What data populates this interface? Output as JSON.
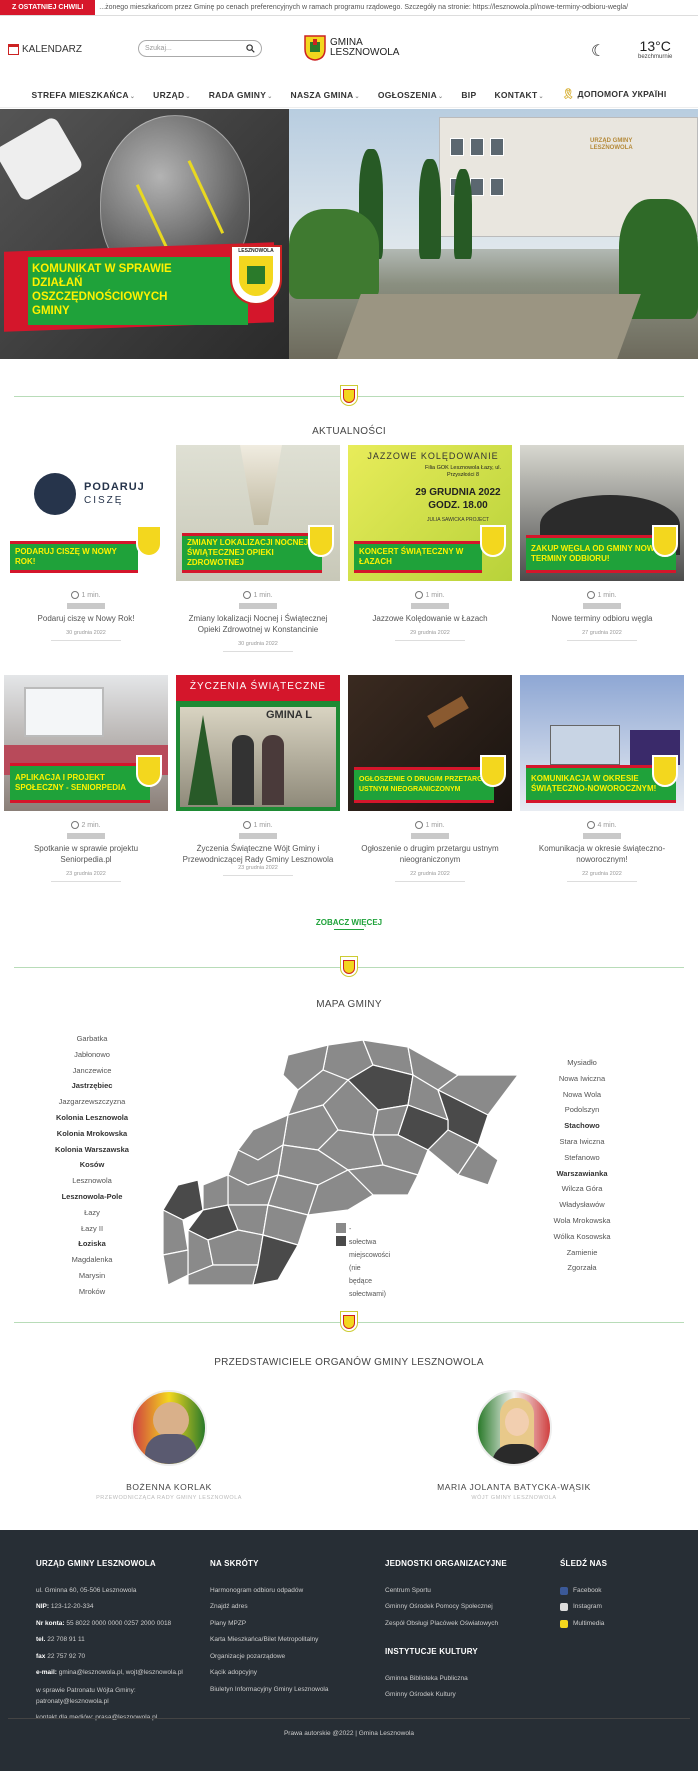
{
  "ticker": {
    "label": "Z OSTATNIEJ CHWILI",
    "text": "...żonego mieszkańcom przez Gminę po cenach preferencyjnych w ramach programu rządowego. Szczegóły na stronie: https://lesznowola.pl/nowe-terminy-odbioru-wegla/"
  },
  "header": {
    "calendar_label": "KALENDARZ",
    "search_placeholder": "Szukaj...",
    "logo_line1": "GMINA",
    "logo_line2": "LESZNOWOLA",
    "temp": "13°C",
    "weather_desc": "bezchmurnie"
  },
  "nav": [
    {
      "label": "STREFA MIESZKAŃCA",
      "caret": "⌄"
    },
    {
      "label": "URZĄD",
      "caret": "⌄"
    },
    {
      "label": "RADA GMINY",
      "caret": "⌄"
    },
    {
      "label": "NASZA GMINA",
      "caret": "⌄"
    },
    {
      "label": "OGŁOSZENIA",
      "caret": "⌄"
    },
    {
      "label": "BIP",
      "caret": ""
    },
    {
      "label": "KONTAKT",
      "caret": "⌄"
    },
    {
      "label": "ДОПОМОГА УКРАЇНІ",
      "caret": ""
    }
  ],
  "hero": {
    "left_banner": "KOMUNIKAT W SPRAWIE DZIAŁAŃ OSZCZĘDNOŚCIOWYCH GMINY",
    "left_crest_label": "LESZNOWOLA",
    "building_sign": "URZĄD GMINY LESZNOWOLA",
    "colors": {
      "red": "#d4162b",
      "green": "#1fa23a",
      "yellow": "#fff200"
    }
  },
  "news": {
    "section_title": "AKTUALNOŚCI",
    "see_more": "ZOBACZ WIĘCEJ",
    "items": [
      {
        "banner": "PODARUJ CISZĘ W NOWY ROK!",
        "time": "1 min.",
        "title": "Podaruj ciszę w Nowy Rok!",
        "date": "30 grudnia 2022",
        "logo_a": "PODARUJ",
        "logo_b": "CISZĘ"
      },
      {
        "banner": "ZMIANY LOKALIZACJI NOCNEJ I ŚWIĄTECZNEJ OPIEKI ZDROWOTNEJ",
        "time": "1 min.",
        "title": "Zmiany lokalizacji Nocnej i Świątecznej Opieki Zdrowotnej w Konstancinie",
        "date": "30 grudnia 2022"
      },
      {
        "banner": "KONCERT ŚWIĄTECZNY W ŁAZACH",
        "time": "1 min.",
        "title": "Jazzowe Kolędowanie w Łazach",
        "date": "29 grudnia 2022",
        "poster_title": "JAZZOWE KOLĘDOWANIE",
        "poster_place": "Filia GOK Lesznowola Łazy, ul. Przyszłości 8",
        "poster_date": "29 GRUDNIA 2022",
        "poster_time": "GODZ. 18.00",
        "poster_artist": "JULIA SAWICKA PROJECT"
      },
      {
        "banner": "ZAKUP WĘGLA OD GMINY NOWE TERMINY ODBIORU!",
        "time": "1 min.",
        "title": "Nowe terminy odbioru węgla",
        "date": "27 grudnia 2022"
      },
      {
        "banner": "APLIKACJA I PROJEKT SPOŁECZNY - SENIORPEDIA",
        "time": "2 min.",
        "title": "Spotkanie w sprawie projektu Seniorpedia.pl",
        "date": "23 grudnia 2022"
      },
      {
        "banner": "",
        "time": "1 min.",
        "title": "Życzenia Świąteczne Wójt Gminy i Przewodniczącej Rady Gminy Lesznowola",
        "date": "23 grudnia 2022",
        "poster_title": "ŻYCZENIA ŚWIĄTECZNE",
        "poster_sign": "GMINA L"
      },
      {
        "banner": "OGŁOSZENIE O DRUGIM PRZETARGU USTNYM NIEOGRANICZONYM",
        "time": "1 min.",
        "title": "Ogłoszenie o drugim przetargu ustnym nieograniczonym",
        "date": "22 grudnia 2022"
      },
      {
        "banner": "KOMUNIKACJA W OKRESIE ŚWIĄTECZNO-NOWOROCZNYM!",
        "time": "4 min.",
        "title": "Komunikacja w okresie świąteczno-noworocznym!",
        "date": "22 grudnia 2022"
      }
    ]
  },
  "map": {
    "section_title": "MAPA GMINY",
    "left_villages": [
      {
        "name": "Garbatka",
        "bold": false
      },
      {
        "name": "Jabłonowo",
        "bold": false
      },
      {
        "name": "Janczewice",
        "bold": false
      },
      {
        "name": "Jastrzębiec",
        "bold": true
      },
      {
        "name": "Jazgarzewszczyzna",
        "bold": false
      },
      {
        "name": "Kolonia Lesznowola",
        "bold": true
      },
      {
        "name": "Kolonia Mrokowska",
        "bold": true
      },
      {
        "name": "Kolonia Warszawska",
        "bold": true
      },
      {
        "name": "Kosów",
        "bold": true
      },
      {
        "name": "Lesznowola",
        "bold": false
      },
      {
        "name": "Lesznowola-Pole",
        "bold": true
      },
      {
        "name": "Łazy",
        "bold": false
      },
      {
        "name": "Łazy II",
        "bold": false
      },
      {
        "name": "Łoziska",
        "bold": true
      },
      {
        "name": "Magdalenka",
        "bold": false
      },
      {
        "name": "Marysin",
        "bold": false
      },
      {
        "name": "Mroków",
        "bold": false
      }
    ],
    "right_villages": [
      {
        "name": "Mysiadło",
        "bold": false
      },
      {
        "name": "Nowa Iwiczna",
        "bold": false
      },
      {
        "name": "Nowa Wola",
        "bold": false
      },
      {
        "name": "Podolszyn",
        "bold": false
      },
      {
        "name": "Stachowo",
        "bold": true
      },
      {
        "name": "Stara Iwiczna",
        "bold": false
      },
      {
        "name": "Stefanowo",
        "bold": false
      },
      {
        "name": "Warszawianka",
        "bold": true
      },
      {
        "name": "Wilcza Góra",
        "bold": false
      },
      {
        "name": "Władysławów",
        "bold": false
      },
      {
        "name": "Wola Mrokowska",
        "bold": false
      },
      {
        "name": "Wólka Kosowska",
        "bold": false
      },
      {
        "name": "Zamienie",
        "bold": false
      },
      {
        "name": "Zgorzała",
        "bold": false
      }
    ],
    "legend_light": "- sołectwa",
    "legend_dark": "- miejscowości (nie będące sołectwami)",
    "color_light": "#8a8a8a",
    "color_dark": "#4a4a4a"
  },
  "officials": {
    "section_title": "PRZEDSTAWICIELE ORGANÓW GMINY LESZNOWOLA",
    "people": [
      {
        "name": "BOŻENNA KORLAK",
        "role": "PRZEWODNICZĄCA RADY GMINY LESZNOWOLA"
      },
      {
        "name": "MARIA JOLANTA BATYCKA-WĄSIK",
        "role": "WÓJT GMINY LESZNOWOLA"
      }
    ]
  },
  "footer": {
    "office": {
      "title": "URZĄD GMINY LESZNOWOLA",
      "address": "ul. Gminna 60, 05-506 Lesznowola",
      "nip_label": "NIP:",
      "nip": "123-12-20-334",
      "account_label": "Nr konta:",
      "account": "55 8022 0000 0000 0257 2000 0018",
      "tel_label": "tel.",
      "tel": "22 708 91 11",
      "fax_label": "fax",
      "fax": "22 757 92 70",
      "email_label": "e-mail:",
      "email": "gmina@lesznowola.pl, wojt@lesznowola.pl",
      "patronage1": "w sprawie Patronatu Wójta Gminy:",
      "patronage2": "patronaty@lesznowola.pl",
      "media": "kontakt dla mediów: prasa@lesznowola.pl"
    },
    "shortcuts": {
      "title": "NA SKRÓTY",
      "items": [
        "Harmonogram odbioru odpadów",
        "Znajdź adres",
        "Plany MPZP",
        "Karta Mieszkańca/Bilet Metropolitalny",
        "Organizacje pozarządowe",
        "Kącik adopcyjny",
        "Biuletyn Informacyjny Gminy Lesznowola"
      ]
    },
    "units": {
      "title": "JEDNOSTKI ORGANIZACYJNE",
      "items": [
        "Centrum Sportu",
        "Gminny Ośrodek Pomocy Społecznej",
        "Zespół Obsługi Placówek Oświatowych"
      ]
    },
    "culture": {
      "title": "INSTYTUCJE KULTURY",
      "items": [
        "Gminna Biblioteka Publiczna",
        "Gminny Ośrodek Kultury"
      ]
    },
    "social": {
      "title": "ŚLEDŹ NAS",
      "items": [
        {
          "label": "Facebook",
          "icon": "facebook-icon",
          "color": "#3b5998"
        },
        {
          "label": "Instagram",
          "icon": "instagram-icon",
          "color": "#dddddd"
        },
        {
          "label": "Multimedia",
          "icon": "crest-icon",
          "color": "#f3d71e"
        }
      ]
    },
    "copyright": "Prawa autorskie @2022 | Gmina Lesznowola"
  }
}
